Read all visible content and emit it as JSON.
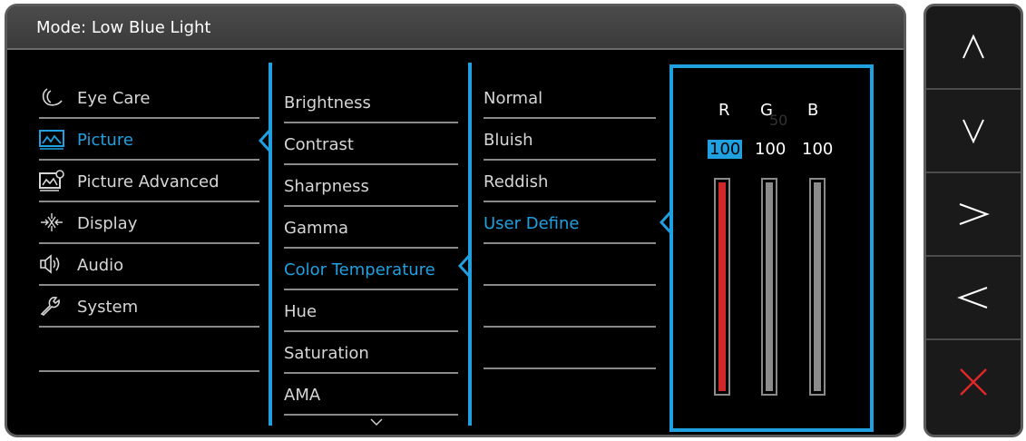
{
  "header": {
    "mode_label": "Mode: Low Blue Light"
  },
  "main_menu": [
    {
      "label": "Eye Care",
      "icon": "eye-care-icon"
    },
    {
      "label": "Picture",
      "icon": "picture-icon",
      "selected": true
    },
    {
      "label": "Picture Advanced",
      "icon": "picture-advanced-icon"
    },
    {
      "label": "Display",
      "icon": "display-icon"
    },
    {
      "label": "Audio",
      "icon": "audio-icon"
    },
    {
      "label": "System",
      "icon": "system-icon"
    },
    {
      "label": ""
    }
  ],
  "picture_menu": [
    {
      "label": "Brightness"
    },
    {
      "label": "Contrast"
    },
    {
      "label": "Sharpness"
    },
    {
      "label": "Gamma"
    },
    {
      "label": "Color Temperature",
      "selected": true
    },
    {
      "label": "Hue"
    },
    {
      "label": "Saturation"
    },
    {
      "label": "AMA"
    }
  ],
  "more_indicator": "chevron-down-icon",
  "color_temp_menu": [
    {
      "label": "Normal"
    },
    {
      "label": "Bluish"
    },
    {
      "label": "Reddish"
    },
    {
      "label": "User Define",
      "selected": true
    },
    {
      "label": ""
    },
    {
      "label": ""
    },
    {
      "label": ""
    }
  ],
  "rgb": {
    "channels": [
      {
        "label": "R",
        "value": "100",
        "level": 1.0,
        "active": true
      },
      {
        "label": "G",
        "value": "100",
        "level": 1.0,
        "active": false
      },
      {
        "label": "B",
        "value": "100",
        "level": 1.0,
        "active": false
      }
    ],
    "ghost_text": "50"
  },
  "control_keys": [
    {
      "name": "up-key",
      "icon": "caret-up-icon"
    },
    {
      "name": "down-key",
      "icon": "caret-down-icon"
    },
    {
      "name": "right-key",
      "icon": "caret-right-icon"
    },
    {
      "name": "left-key",
      "icon": "caret-left-icon"
    },
    {
      "name": "exit-key",
      "icon": "close-icon"
    }
  ],
  "colors": {
    "accent": "#1fa0e0",
    "red_bar": "#d0282a",
    "gray_bar": "#8c8c8c",
    "close": "#e0282a"
  }
}
